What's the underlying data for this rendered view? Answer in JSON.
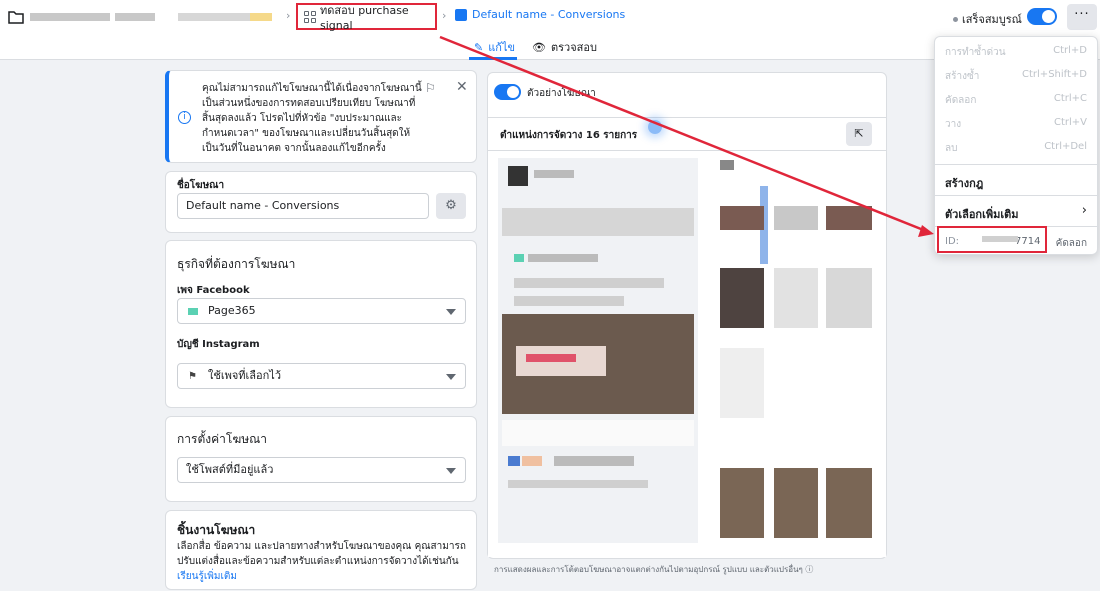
{
  "topbar": {
    "campaign_label": "ทดสอบ purchase signal",
    "ad_label": "Default name - Conversions",
    "status_label": "เสร็จสมบูรณ์",
    "more_label": "···",
    "tab_edit": "แก้ไข",
    "tab_review": "ตรวจสอบ"
  },
  "notice": {
    "message": "คุณไม่สามารถแก้ไขโฆษณานี้ได้เนื่องจากโฆษณานี้เป็นส่วนหนึ่งของการทดสอบเปรียบเทียบ โฆษณาที่สิ้นสุดลงแล้ว โปรดไปที่หัวข้อ \"งบประมาณและกำหนดเวลา\" ของโฆษณาและเปลี่ยนวันสิ้นสุดให้เป็นวันที่ในอนาคต จากนั้นลองแก้ไขอีกครั้ง"
  },
  "ad_name": {
    "label": "ชื่อโฆษณา",
    "value": "Default name - Conversions"
  },
  "identity": {
    "title": "ธุรกิจที่ต้องการโฆษณา",
    "facebook_label": "เพจ Facebook",
    "facebook_value": "Page365",
    "instagram_label": "บัญชี Instagram",
    "instagram_value": "ใช้เพจที่เลือกไว้"
  },
  "ad_setup": {
    "title": "การตั้งค่าโฆษณา",
    "value": "ใช้โพสต์ที่มีอยู่แล้ว"
  },
  "creative": {
    "title": "ชิ้นงานโฆษณา",
    "description": "เลือกสื่อ ข้อความ และปลายทางสำหรับโฆษณาของคุณ คุณสามารถปรับแต่งสื่อและข้อความสำหรับแต่ละตำแหน่งการจัดวางได้เช่นกัน",
    "learn_more": "เรียนรู้เพิ่มเติม"
  },
  "preview": {
    "toggle_label": "ตัวอย่างโฆษณา",
    "placements_title": "ตำแหน่งการจัดวาง 16 รายการ",
    "footer": "การแสดงผลและการโต้ตอบโฆษณาอาจแตกต่างกันไปตามอุปกรณ์ รูปแบบ และตัวแปรอื่นๆ"
  },
  "menu": {
    "items": [
      {
        "label": "การทำซ้ำด่วน",
        "shortcut": "Ctrl+D"
      },
      {
        "label": "สร้างซ้ำ",
        "shortcut": "Ctrl+Shift+D"
      },
      {
        "label": "คัดลอก",
        "shortcut": "Ctrl+C"
      },
      {
        "label": "วาง",
        "shortcut": "Ctrl+V"
      },
      {
        "label": "ลบ",
        "shortcut": "Ctrl+Del"
      }
    ],
    "create_rule": "สร้างกฎ",
    "more_options": "ตัวเลือกเพิ่มเติม",
    "id_prefix": "ID:",
    "id_suffix": "7714",
    "copy_label": "คัดลอก"
  },
  "colors": {
    "accent": "#1877f2",
    "annotation": "#e0263a"
  }
}
